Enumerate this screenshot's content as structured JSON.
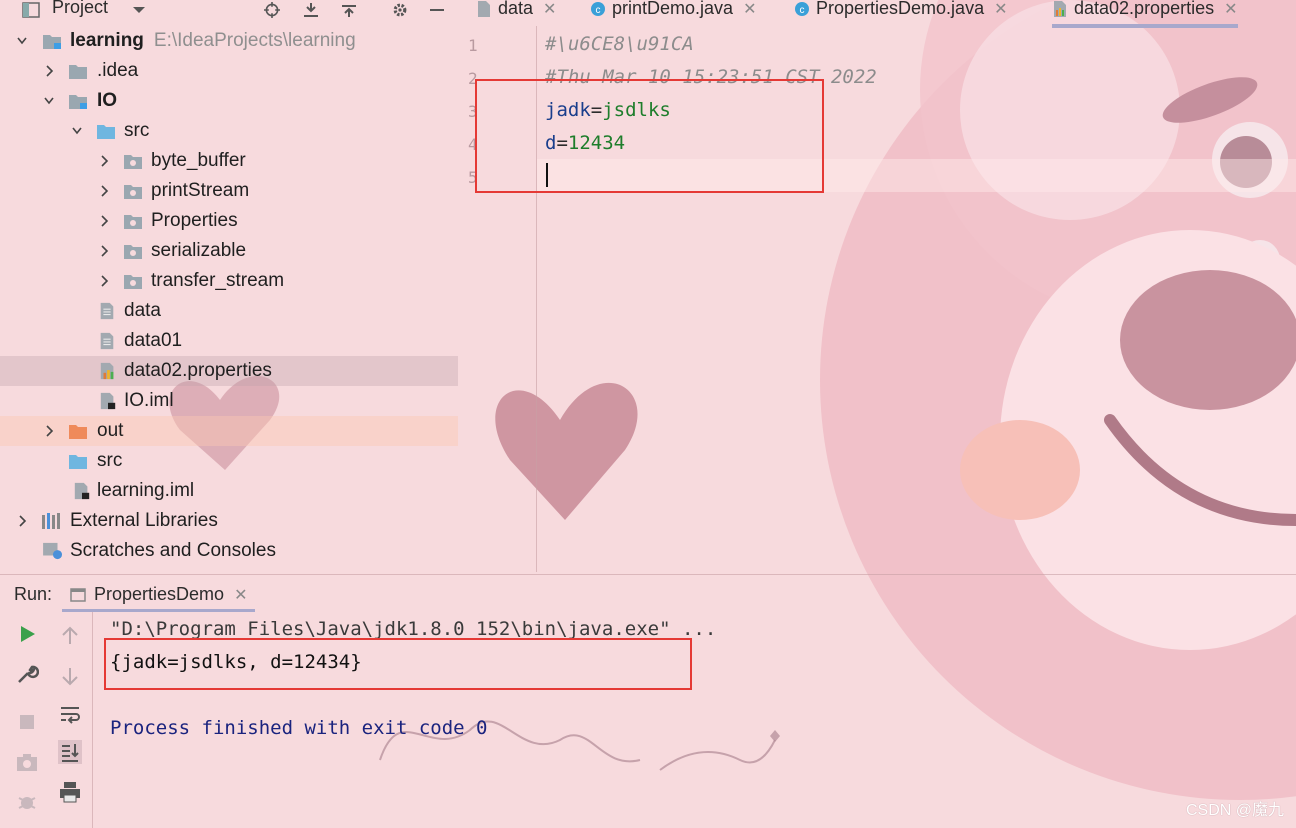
{
  "project_panel": {
    "title": "Project",
    "tree": [
      {
        "label": "learning",
        "path": "E:\\IdeaProjects\\learning"
      },
      {
        "label": ".idea"
      },
      {
        "label": "IO"
      },
      {
        "label": "src"
      },
      {
        "label": "byte_buffer"
      },
      {
        "label": "printStream"
      },
      {
        "label": "Properties"
      },
      {
        "label": "serializable"
      },
      {
        "label": "transfer_stream"
      },
      {
        "label": "data"
      },
      {
        "label": "data01"
      },
      {
        "label": "data02.properties"
      },
      {
        "label": "IO.iml"
      },
      {
        "label": "out"
      },
      {
        "label": "src"
      },
      {
        "label": "learning.iml"
      },
      {
        "label": "External Libraries"
      },
      {
        "label": "Scratches and Consoles"
      }
    ]
  },
  "editor": {
    "tabs": [
      {
        "label": "data"
      },
      {
        "label": "printDemo.java"
      },
      {
        "label": "PropertiesDemo.java"
      },
      {
        "label": "data02.properties"
      }
    ],
    "close_glyph": "✕",
    "line_numbers": [
      "1",
      "2",
      "3",
      "4",
      "5"
    ],
    "lines": {
      "l1": "#\\u6CE8\\u91CA",
      "l2": "#Thu Mar 10 15:23:51 CST 2022",
      "l3_key": "jadk",
      "l3_eq": "=",
      "l3_val": "jsdlks",
      "l4_key": "d",
      "l4_eq": "=",
      "l4_val": "12434"
    }
  },
  "run_panel": {
    "title": "Run:",
    "tab_label": "PropertiesDemo",
    "console": {
      "command": "\"D:\\Program Files\\Java\\jdk1.8.0_152\\bin\\java.exe\" ...",
      "output": "{jadk=jsdlks, d=12434}",
      "exit": "Process finished with exit code 0"
    }
  },
  "watermark": "CSDN @魔九",
  "colors": {
    "highlight_box": "#e53935",
    "background": "#f7dadd",
    "run_icon": "#3aa04b"
  }
}
